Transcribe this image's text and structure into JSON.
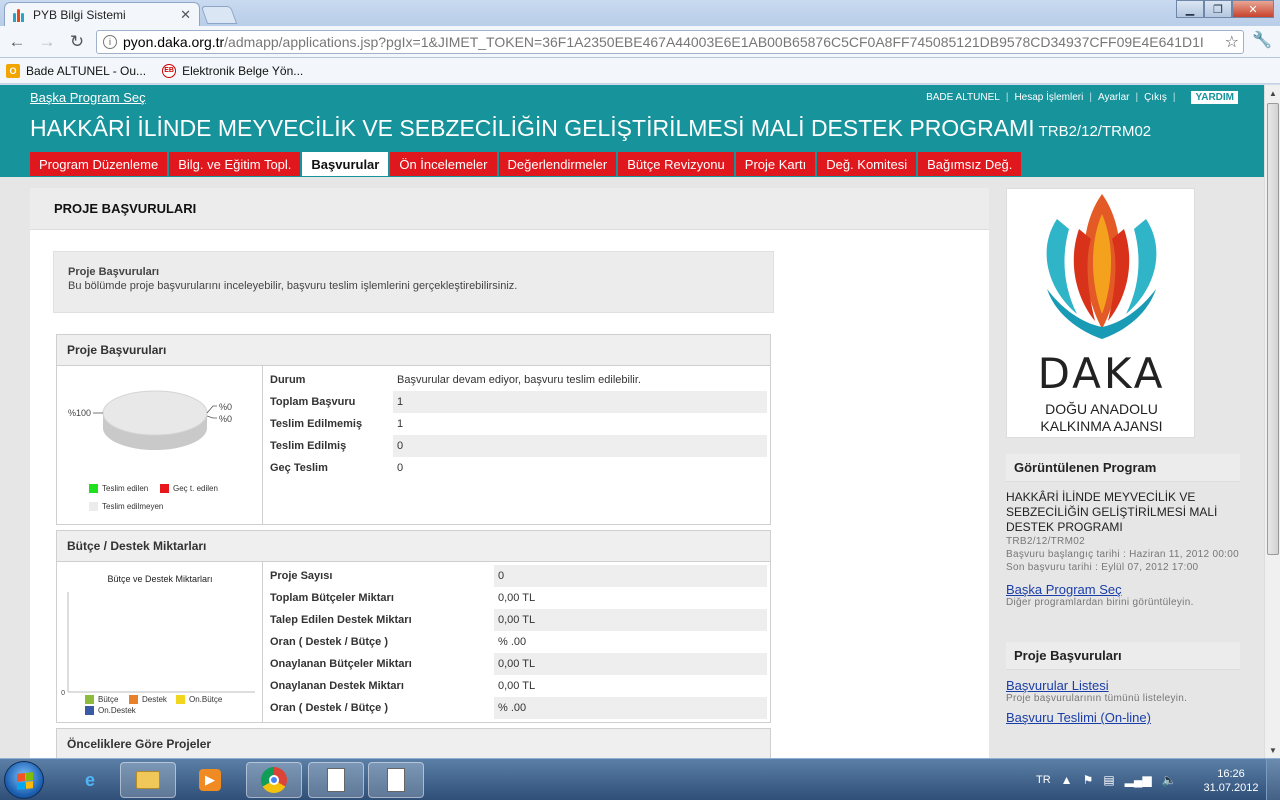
{
  "browser": {
    "tab_title": "PYB Bilgi Sistemi",
    "url_host": "pyon.daka.org.tr",
    "url_path": "/admapp/applications.jsp?pgIx=1&JIMET_TOKEN=36F1A2350EBE467A44003E6E1AB00B65876C5CF0A8FF745085121DB9578CD34937CFF09E4E641D1I",
    "bookmarks": [
      {
        "label": "Bade ALTUNEL - Ou...",
        "icon": "outlook-icon"
      },
      {
        "label": "Elektronik Belge Yön...",
        "icon": "ebys-icon"
      }
    ]
  },
  "header": {
    "other_program": "Başka Program Seç",
    "user": "BADE ALTUNEL",
    "account": "Hesap İşlemleri",
    "settings": "Ayarlar",
    "logout": "Çıkış",
    "help": "YARDIM",
    "program_title": "HAKKÂRİ İLİNDE MEYVECİLİK VE SEBZECİLİĞİN GELİŞTİRİLMESİ MALİ DESTEK PROGRAMI",
    "program_code": "TRB2/12/TRM02"
  },
  "nav": [
    {
      "label": "Program Düzenleme",
      "active": false
    },
    {
      "label": "Bilg. ve Eğitim Topl.",
      "active": false
    },
    {
      "label": "Başvurular",
      "active": true
    },
    {
      "label": "Ön İncelemeler",
      "active": false
    },
    {
      "label": "Değerlendirmeler",
      "active": false
    },
    {
      "label": "Bütçe Revizyonu",
      "active": false
    },
    {
      "label": "Proje Kartı",
      "active": false
    },
    {
      "label": "Değ. Komitesi",
      "active": false
    },
    {
      "label": "Bağımsız Değ.",
      "active": false
    }
  ],
  "main": {
    "page_title": "PROJE BAŞVURULARI",
    "info_title": "Proje Başvuruları",
    "info_desc": "Bu bölümde proje başvurularını inceleyebilir, başvuru teslim işlemlerini gerçekleştirebilirsiniz.",
    "panel1": {
      "title": "Proje Başvuruları",
      "rows": [
        {
          "label": "Durum",
          "value": "Başvurular devam ediyor, başvuru teslim edilebilir."
        },
        {
          "label": "Toplam Başvuru",
          "value": "1"
        },
        {
          "label": "Teslim Edilmemiş",
          "value": "1"
        },
        {
          "label": "Teslim Edilmiş",
          "value": "0"
        },
        {
          "label": "Geç Teslim",
          "value": "0"
        }
      ]
    },
    "panel2": {
      "title": "Bütçe / Destek Miktarları",
      "rows": [
        {
          "label": "Proje Sayısı",
          "value": "0"
        },
        {
          "label": "Toplam Bütçeler Miktarı",
          "value": "0,00 TL"
        },
        {
          "label": "Talep Edilen Destek Miktarı",
          "value": "0,00 TL"
        },
        {
          "label": "Oran ( Destek / Bütçe )",
          "value": "% .00"
        },
        {
          "label": "Onaylanan Bütçeler Miktarı",
          "value": "0,00 TL"
        },
        {
          "label": "Onaylanan Destek Miktarı",
          "value": "0,00 TL"
        },
        {
          "label": "Oran ( Destek / Bütçe )",
          "value": "% .00"
        }
      ]
    },
    "panel3": {
      "title": "Önceliklere Göre Projeler"
    }
  },
  "chart_data": [
    {
      "type": "pie",
      "labels": [
        "%100",
        "%0",
        "%0"
      ],
      "legend": [
        "Teslim edilen",
        "Geç t. edilen",
        "Teslim edilmeyen"
      ],
      "values": [
        0,
        0,
        1
      ],
      "colors": [
        "#1fe01f",
        "#e8171c",
        "#e8e8e8"
      ]
    },
    {
      "type": "bar",
      "title": "Bütçe ve Destek Miktarları",
      "y_tick": "0",
      "series": [
        {
          "name": "Bütçe",
          "values": [
            0
          ],
          "color": "#8dbb3c"
        },
        {
          "name": "Destek",
          "values": [
            0
          ],
          "color": "#e8802c"
        },
        {
          "name": "On.Bütçe",
          "values": [
            0
          ],
          "color": "#f2d51e"
        },
        {
          "name": "On.Destek",
          "values": [
            0
          ],
          "color": "#3a5aa8"
        }
      ]
    }
  ],
  "sidebar": {
    "logo_text": "DAKA",
    "logo_sub1": "DOĞU ANADOLU",
    "logo_sub2": "KALKINMA AJANSI",
    "viewed_title": "Görüntülenen Program",
    "program_name": "HAKKÂRİ İLİNDE MEYVECİLİK VE SEBZECİLİĞİN GELİŞTİRİLMESİ MALİ DESTEK PROGRAMI",
    "program_code": "TRB2/12/TRM02",
    "start_date": "Başvuru başlangıç tarihi : Haziran 11, 2012 00:00",
    "end_date": "Son başvuru tarihi : Eylül 07, 2012 17:00",
    "other_link": "Başka Program Seç",
    "other_desc": "Diğer programlardan birini görüntüleyin.",
    "apps_title": "Proje Başvuruları",
    "list_link": "Başvurular Listesi",
    "list_desc": "Proje başvurularının tümünü listeleyin.",
    "submit_link": "Başvuru Teslimi (On-line)"
  },
  "taskbar": {
    "lang": "TR",
    "time": "16:26",
    "date": "31.07.2012"
  }
}
